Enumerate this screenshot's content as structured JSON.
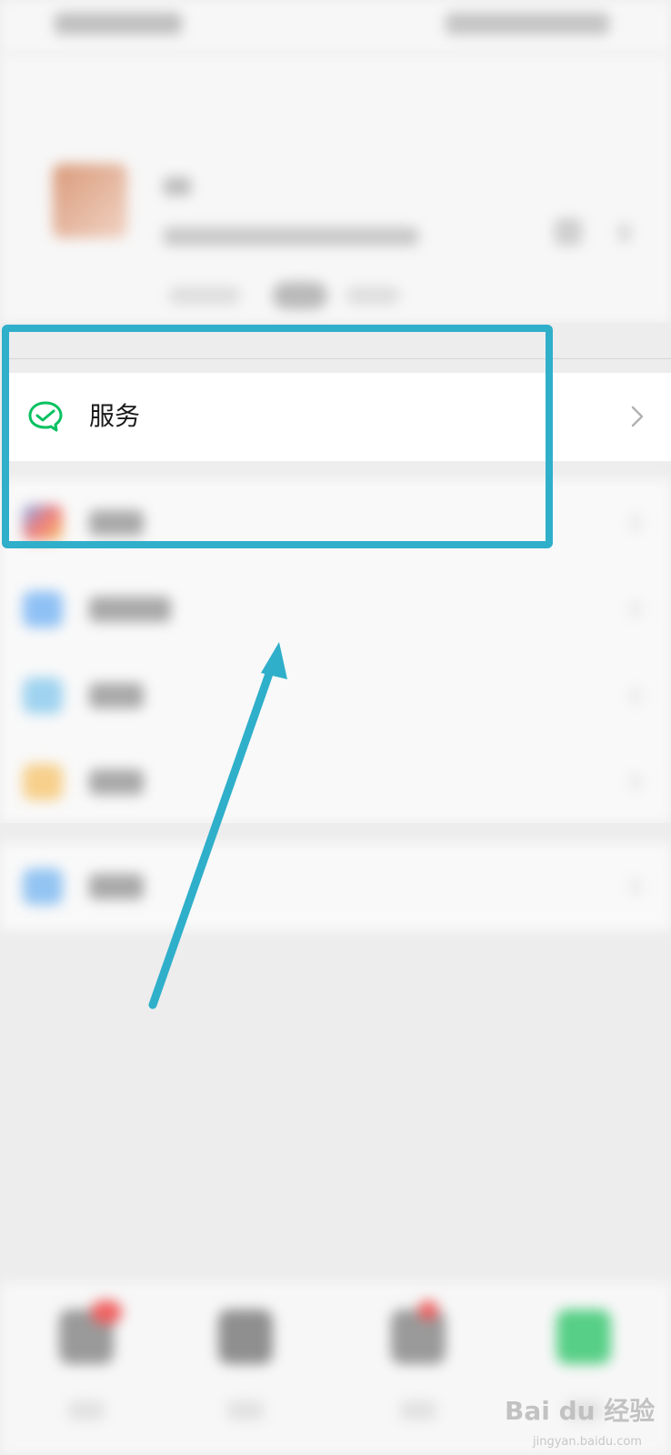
{
  "service": {
    "label": "服务",
    "icon": "wechat-pay-icon",
    "chevron_icon": "chevron-right-icon"
  },
  "watermark": {
    "brand": "Bai du 经验",
    "url": "jingyan.baidu.com"
  },
  "annotation": {
    "box_color": "#2fafca",
    "arrow_color": "#2fafca"
  },
  "colors": {
    "service_icon": "#07c160",
    "background": "#ededed"
  }
}
